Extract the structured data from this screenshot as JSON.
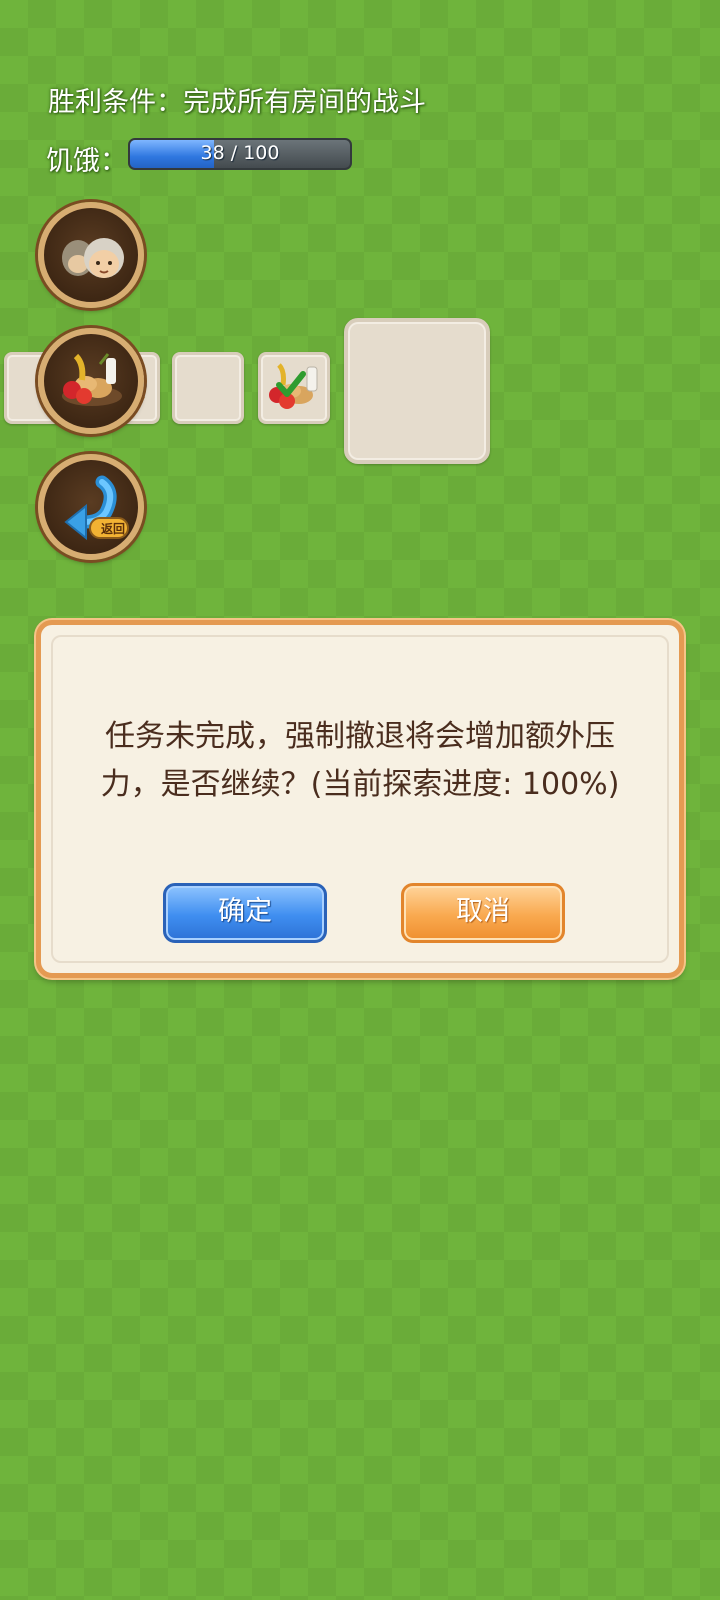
{
  "hud": {
    "victory_condition": "胜利条件：完成所有房间的战斗",
    "hunger_label": "饥饿：",
    "hunger_current": 38,
    "hunger_max": 100,
    "hunger_text": "38 / 100"
  },
  "side_buttons": [
    {
      "icon": "character-portrait-icon"
    },
    {
      "icon": "food-supplies-icon"
    },
    {
      "icon": "return-icon",
      "label": "返回"
    }
  ],
  "map_rooms": [
    {
      "state": "empty"
    },
    {
      "state": "visited"
    },
    {
      "state": "empty"
    },
    {
      "state": "food-collected"
    },
    {
      "state": "current"
    }
  ],
  "dialog": {
    "message_line1": "任务未完成，强制撤退将会增加额外压",
    "message_line2": "力，是否继续？(当前探索进度: 100%)",
    "confirm_label": "确定",
    "cancel_label": "取消"
  },
  "colors": {
    "background": "#6fb43c",
    "confirm_button": "#3f8ef0",
    "cancel_button": "#f9a94f",
    "dialog_border": "#e49a52"
  }
}
